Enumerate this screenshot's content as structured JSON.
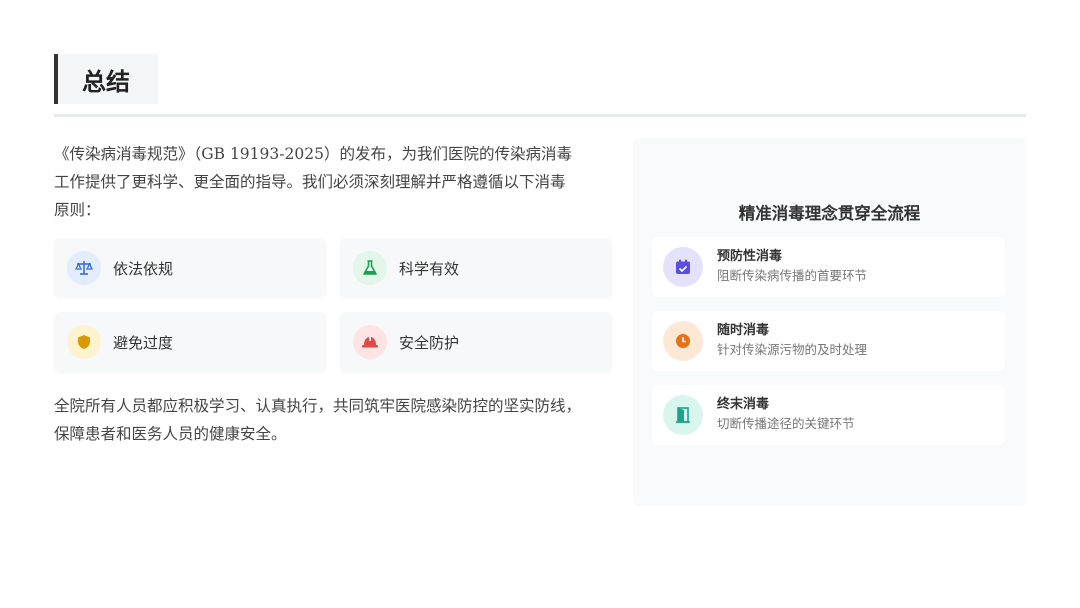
{
  "header": {
    "title": "总结"
  },
  "intro": {
    "line1": "《传染病消毒规范》（GB 19193-2025）的发布，为我们医院的传染病消毒",
    "line2": "工作提供了更科学、更全面的指导。我们必须深刻理解并严格遵循以下消毒",
    "line3": "原则："
  },
  "principles": [
    {
      "label": "依法依规",
      "icon": "scale-icon",
      "color": "#3b6fd6",
      "bg": "#e3ecfb"
    },
    {
      "label": "科学有效",
      "icon": "flask-icon",
      "color": "#1f9d55",
      "bg": "#e2f6ea"
    },
    {
      "label": "避免过度",
      "icon": "shield-icon",
      "color": "#d99a06",
      "bg": "#fdf3cf"
    },
    {
      "label": "安全防护",
      "icon": "hardhat-icon",
      "color": "#e04848",
      "bg": "#fde3e3"
    }
  ],
  "closing": {
    "line1": "全院所有人员都应积极学习、认真执行，共同筑牢医院感染防控的坚实防线，",
    "line2": "保障患者和医务人员的健康安全。"
  },
  "panel": {
    "title": "精准消毒理念贯穿全流程",
    "items": [
      {
        "title": "预防性消毒",
        "desc": "阻断传染病传播的首要环节",
        "icon": "calendar-check-icon",
        "color": "#5b4ee0",
        "bg": "#e4e2fb"
      },
      {
        "title": "随时消毒",
        "desc": "针对传染源污物的及时处理",
        "icon": "clock-icon",
        "color": "#e8711a",
        "bg": "#fde8d6"
      },
      {
        "title": "终末消毒",
        "desc": "切断传播途径的关键环节",
        "icon": "door-exit-icon",
        "color": "#18a58a",
        "bg": "#d8f5ee"
      }
    ]
  }
}
